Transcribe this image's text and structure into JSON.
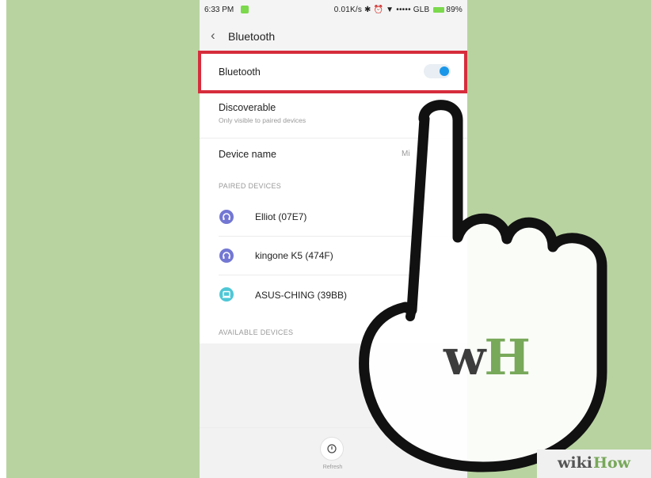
{
  "status_bar": {
    "time": "6:33 PM",
    "network_speed": "0.01K/s",
    "indicators": "✱ ⏰ ▼ •••••",
    "carrier": "GLB",
    "battery_level": "89%"
  },
  "header": {
    "title": "Bluetooth",
    "back_icon": "chevron-left-icon"
  },
  "settings": {
    "bluetooth": {
      "label": "Bluetooth",
      "enabled": true
    },
    "discoverable": {
      "label": "Discoverable",
      "subtitle": "Only visible to paired devices"
    },
    "device_name": {
      "label": "Device name",
      "value": "Mi"
    }
  },
  "paired_devices": {
    "header": "PAIRED DEVICES",
    "items": [
      {
        "name": "Elliot (07E7)",
        "icon": "headset-icon",
        "color": "#7377d3"
      },
      {
        "name": "kingone K5 (474F)",
        "icon": "headset-icon",
        "color": "#7377d3"
      },
      {
        "name": "ASUS-CHING (39BB)",
        "icon": "laptop-icon",
        "color": "#4ec7d6"
      }
    ]
  },
  "available_devices": {
    "header": "AVAILABLE DEVICES"
  },
  "refresh": {
    "label": "Refresh"
  },
  "colors": {
    "highlight": "#d62d3c",
    "toggle_on": "#1a96e8",
    "background": "#b8d3a0",
    "brand_green": "#78a85a"
  },
  "watermark": {
    "logo_w": "w",
    "logo_h": "H",
    "wiki": "wiki",
    "how": "How"
  }
}
